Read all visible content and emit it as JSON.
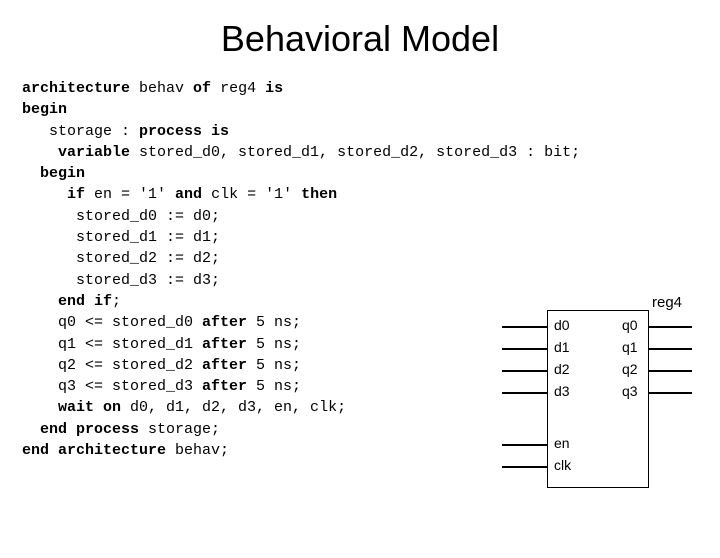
{
  "title": "Behavioral Model",
  "code": {
    "l1a": "architecture",
    "l1b": " behav ",
    "l1c": "of",
    "l1d": " reg4 ",
    "l1e": "is",
    "l2": "begin",
    "l3a": "   storage : ",
    "l3b": "process is",
    "l4a": "    ",
    "l4b": "variable",
    "l4c": " stored_d0, stored_d1, stored_d2, stored_d3 : bit;",
    "l5a": "  ",
    "l5b": "begin",
    "l6a": "     ",
    "l6b": "if",
    "l6c": " en = '1' ",
    "l6d": "and",
    "l6e": " clk = '1' ",
    "l6f": "then",
    "l7": "      stored_d0 := d0;",
    "l8": "      stored_d1 := d1;",
    "l9": "      stored_d2 := d2;",
    "l10": "      stored_d3 := d3;",
    "l11a": "    ",
    "l11b": "end if",
    "l11c": ";",
    "l12a": "    q0 <= stored_d0 ",
    "l12b": "after",
    "l12c": " 5 ns;",
    "l13a": "    q1 <= stored_d1 ",
    "l13b": "after",
    "l13c": " 5 ns;",
    "l14a": "    q2 <= stored_d2 ",
    "l14b": "after",
    "l14c": " 5 ns;",
    "l15a": "    q3 <= stored_d3 ",
    "l15b": "after",
    "l15c": " 5 ns;",
    "l16a": "    ",
    "l16b": "wait on",
    "l16c": " d0, d1, d2, d3, en, clk;",
    "l17a": "  ",
    "l17b": "end process",
    "l17c": " storage;",
    "l18a": "",
    "l18b": "end architecture",
    "l18c": " behav;"
  },
  "diagram": {
    "title": "reg4",
    "left": [
      "d0",
      "d1",
      "d2",
      "d3",
      "en",
      "clk"
    ],
    "right": [
      "q0",
      "q1",
      "q2",
      "q3"
    ]
  }
}
